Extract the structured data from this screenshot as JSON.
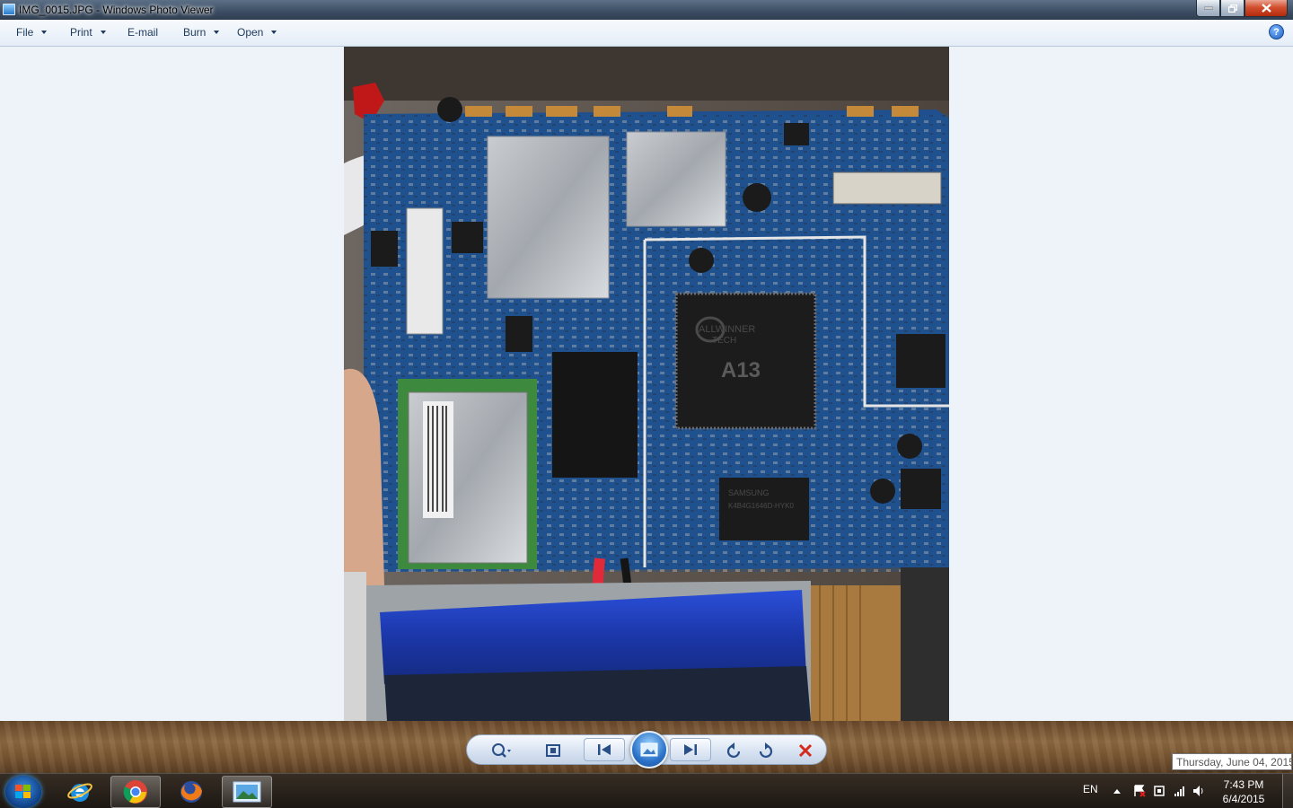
{
  "window": {
    "title": "IMG_0015.JPG - Windows Photo Viewer",
    "app_icon": "photo-viewer-icon"
  },
  "menu": {
    "items": [
      {
        "label": "File",
        "has_dropdown": true
      },
      {
        "label": "Print",
        "has_dropdown": true
      },
      {
        "label": "E-mail",
        "has_dropdown": false
      },
      {
        "label": "Burn",
        "has_dropdown": true
      },
      {
        "label": "Open",
        "has_dropdown": true
      }
    ],
    "help_label": "?"
  },
  "photo": {
    "chip_label": "A13",
    "chip_brand_1": "ALLWINNER",
    "chip_brand_2": "TECH",
    "ram_label_1": "SAMSUNG",
    "ram_label_2": "K4B4G1646D-HYK0"
  },
  "controls": {
    "buttons": [
      "zoom-icon",
      "actual-size-icon",
      "previous-icon",
      "slideshow-icon",
      "next-icon",
      "rotate-counterclockwise-icon",
      "rotate-clockwise-icon",
      "delete-icon"
    ]
  },
  "taskbar": {
    "apps": [
      "internet-explorer-icon",
      "chrome-icon",
      "firefox-icon",
      "photo-viewer-icon"
    ],
    "active_app": "photo-viewer-icon"
  },
  "tray": {
    "language": "EN",
    "time": "7:43 PM",
    "date": "6/4/2015",
    "icons": [
      "action-center-icon",
      "network-adapter-icon",
      "signal-icon",
      "volume-icon"
    ]
  },
  "tooltip": {
    "text": "Thursday, June 04, 2015"
  },
  "colors": {
    "pcb": "#1f4f8f",
    "viewer_bg": "#eef3fa",
    "battery": "#1e3fb8"
  }
}
